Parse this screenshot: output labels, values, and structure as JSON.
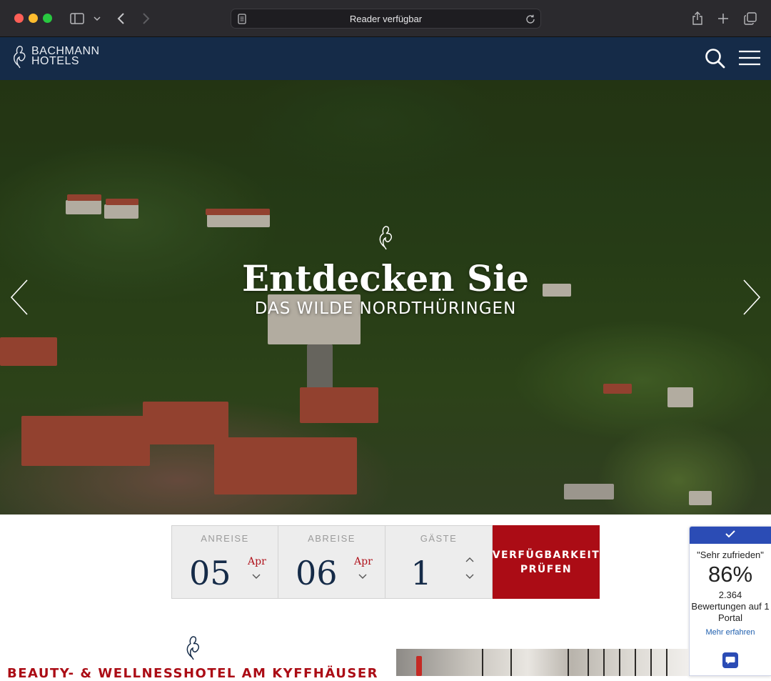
{
  "browser": {
    "url_text": "Reader verfügbar"
  },
  "header": {
    "logo_line1": "BACHMANN",
    "logo_line2": "HOTELS"
  },
  "hero": {
    "title": "Entdecken Sie",
    "subtitle": "DAS WILDE NORDTHÜRINGEN"
  },
  "booking": {
    "arrival_label": "ANREISE",
    "arrival_day": "05",
    "arrival_month": "Apr",
    "departure_label": "ABREISE",
    "departure_day": "06",
    "departure_month": "Apr",
    "guests_label": "GÄSTE",
    "guests_value": "1",
    "submit_label": "VERFÜGBARKEIT PRÜFEN"
  },
  "rating": {
    "quote": "\"Sehr zufrieden\"",
    "percent": "86%",
    "count": "2.364",
    "text": "Bewertungen auf 1 Portal",
    "link": "Mehr erfahren"
  },
  "section": {
    "heading": "BEAUTY- & WELLNESSHOTEL AM KYFFHÄUSER"
  },
  "colors": {
    "header_bg": "#152b48",
    "accent_red": "#ab0c15",
    "rating_blue": "#2b4cb5"
  }
}
